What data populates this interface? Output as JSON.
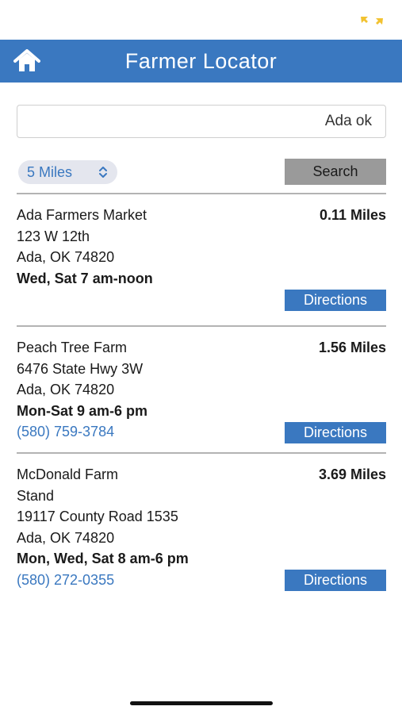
{
  "header": {
    "title": "Farmer Locator"
  },
  "search": {
    "value": "Ada ok",
    "radius": "5 Miles",
    "button_label": "Search"
  },
  "results": [
    {
      "name_lines": [
        "Ada Farmers Market"
      ],
      "address": "123 W 12th",
      "city": "Ada, OK 74820",
      "hours": "Wed, Sat 7 am-noon",
      "phone": "",
      "distance": "0.11 Miles",
      "directions_label": "Directions"
    },
    {
      "name_lines": [
        "Peach Tree Farm"
      ],
      "address": "6476 State Hwy 3W",
      "city": "Ada, OK 74820",
      "hours": "Mon-Sat 9 am-6 pm",
      "phone": "(580) 759-3784",
      "distance": "1.56 Miles",
      "directions_label": "Directions"
    },
    {
      "name_lines": [
        "McDonald Farm",
        "Stand"
      ],
      "address": "19117 County Road 1535",
      "city": "Ada, OK 74820",
      "hours": "Mon, Wed, Sat 8 am-6 pm",
      "phone": "(580) 272-0355",
      "distance": "3.69 Miles",
      "directions_label": "Directions"
    }
  ],
  "colors": {
    "accent": "#3a78c0",
    "search_button": "#9a9a9a",
    "status_icon": "#f2c230"
  },
  "icons": {
    "home": "home-icon",
    "select": "chevron-up-down-icon",
    "status": "expand-arrows-icon"
  }
}
